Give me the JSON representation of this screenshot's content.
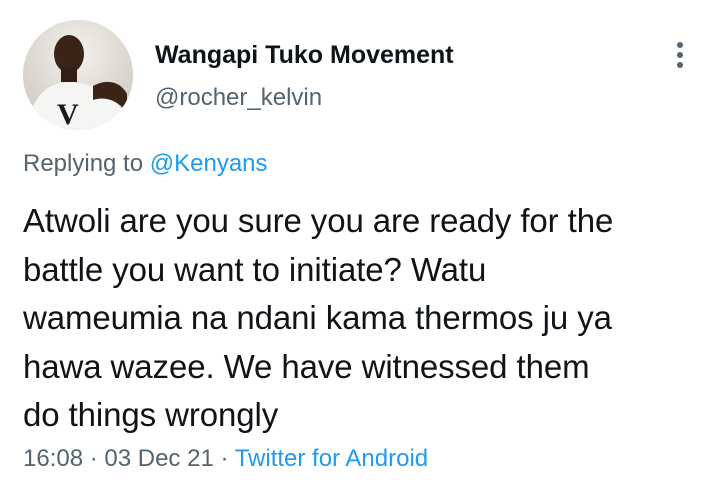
{
  "author": {
    "display_name": "Wangapi Tuko Movement",
    "handle": "@rocher_kelvin"
  },
  "reply": {
    "prefix": "Replying to ",
    "mention": "@Kenyans"
  },
  "tweet": {
    "lines": [
      "Atwoli are you sure you are ready for the",
      "battle you want to initiate? Watu",
      "wameumia na ndani kama thermos ju ya",
      "hawa wazee. We have witnessed them",
      "do things wrongly"
    ]
  },
  "meta": {
    "time": "16:08",
    "sep1": " · ",
    "date": "03 Dec 21",
    "sep2": " · ",
    "source": "Twitter for Android"
  },
  "icons": {
    "more": "more-vertical-icon"
  },
  "colors": {
    "text_primary": "#0f1419",
    "text_secondary": "#536471",
    "accent": "#1d9bf0"
  }
}
